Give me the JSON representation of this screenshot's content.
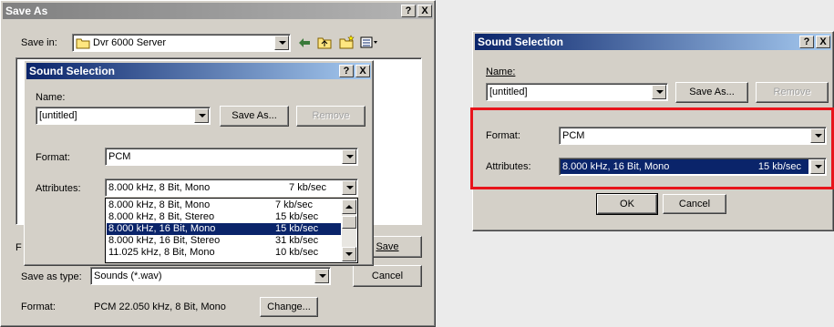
{
  "save_as": {
    "title": "Save As",
    "help_btn": "?",
    "close_btn": "X",
    "save_in_label": "Save in:",
    "save_in_value": "Dvr 6000 Server",
    "file_name_label": "F",
    "save_button": "Save",
    "cancel_button": "Cancel",
    "save_type_label": "Save as type:",
    "save_type_value": "Sounds (*.wav)",
    "format_label": "Format:",
    "format_value": "PCM 22.050 kHz, 8 Bit, Mono",
    "change_button": "Change..."
  },
  "inner_dialog": {
    "title": "Sound Selection",
    "help_btn": "?",
    "close_btn": "X",
    "name_label": "Name:",
    "name_value": "[untitled]",
    "save_as_button": "Save As...",
    "remove_button": "Remove",
    "format_label": "Format:",
    "format_value": "PCM",
    "attributes_label": "Attributes:",
    "attributes_value": "8.000 kHz, 8 Bit, Mono",
    "attributes_rate": "7 kb/sec",
    "list": [
      {
        "format": "8.000 kHz, 8 Bit, Mono",
        "rate": "7 kb/sec"
      },
      {
        "format": "8.000 kHz, 8 Bit, Stereo",
        "rate": "15 kb/sec"
      },
      {
        "format": "8.000 kHz, 16 Bit, Mono",
        "rate": "15 kb/sec"
      },
      {
        "format": "8.000 kHz, 16 Bit, Stereo",
        "rate": "31 kb/sec"
      },
      {
        "format": "11.025 kHz, 8 Bit, Mono",
        "rate": "10 kb/sec"
      }
    ],
    "selected_index": 2
  },
  "right_dialog": {
    "title": "Sound Selection",
    "help_btn": "?",
    "close_btn": "X",
    "name_label": "Name:",
    "name_value": "[untitled]",
    "save_as_button": "Save As...",
    "remove_button": "Remove",
    "format_label": "Format:",
    "format_value": "PCM",
    "attributes_label": "Attributes:",
    "attributes_value": "8.000 kHz, 16 Bit, Mono",
    "attributes_rate": "15 kb/sec",
    "ok_button": "OK",
    "cancel_button": "Cancel"
  },
  "colors": {
    "highlight": "#e8141b",
    "selection": "#0a246a",
    "face": "#d4d0c8"
  }
}
